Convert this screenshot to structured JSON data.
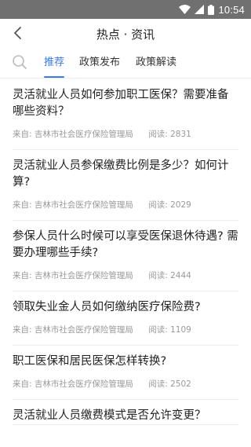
{
  "status_bar": {
    "time": "10:54",
    "icons": [
      "wifi-icon",
      "signal-icon",
      "battery-icon"
    ]
  },
  "nav": {
    "title": "热点 · 资讯",
    "back_icon": "chevron-left-icon"
  },
  "tabs": {
    "search_icon": "search-icon",
    "items": [
      {
        "label": "推荐",
        "active": true
      },
      {
        "label": "政策发布",
        "active": false
      },
      {
        "label": "政策解读",
        "active": false
      }
    ],
    "accent_color": "#3b7be8"
  },
  "articles": [
    {
      "title": "灵活就业人员如何参加职工医保？需要准备哪些资料？",
      "source": "来自: 吉林市社会医疗保险管理局",
      "reads": "阅读: 2831"
    },
    {
      "title": "灵活就业人员参保缴费比例是多少？如何计算?",
      "source": "来自: 吉林市社会医疗保险管理局",
      "reads": "阅读: 2029"
    },
    {
      "title": "参保人员什么时候可以享受医保退休待遇? 需要办理哪些手续?",
      "source": "来自: 吉林市社会医疗保险管理局",
      "reads": "阅读: 2444"
    },
    {
      "title": "领取失业金人员如何缴纳医疗保险费?",
      "source": "来自: 吉林市社会医疗保险管理局",
      "reads": "阅读: 1109"
    },
    {
      "title": "职工医保和居民医保怎样转换?",
      "source": "来自: 吉林市社会医疗保险管理局",
      "reads": "阅读: 2502"
    },
    {
      "title": "灵活就业人员缴费模式是否允许变更？",
      "source": "",
      "reads": ""
    }
  ]
}
